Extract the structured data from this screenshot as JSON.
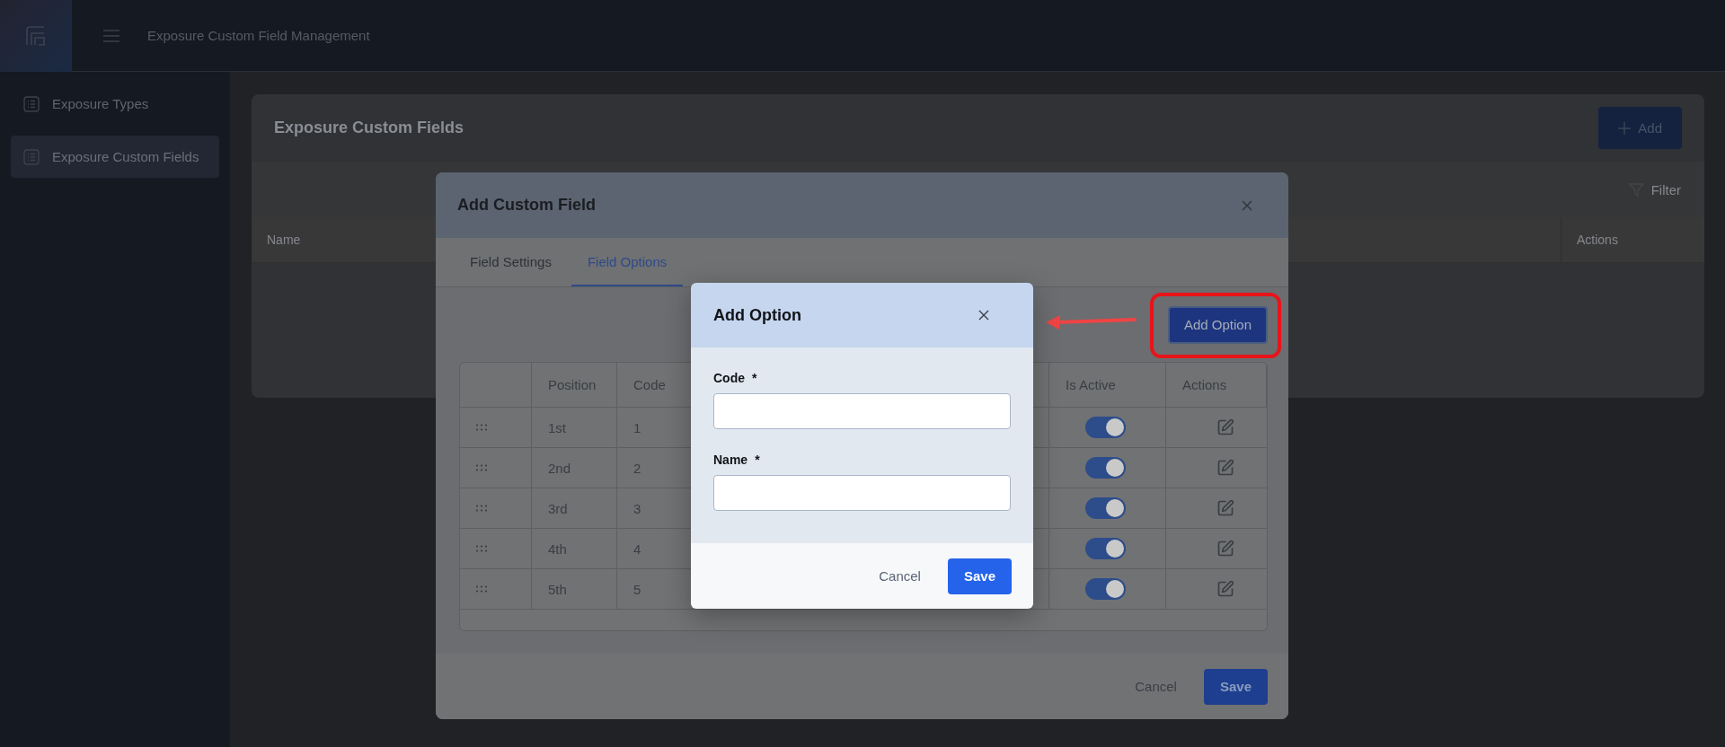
{
  "header": {
    "title": "Exposure Custom Field Management"
  },
  "sidebar": {
    "items": [
      {
        "label": "Exposure Types",
        "selected": false
      },
      {
        "label": "Exposure Custom Fields",
        "selected": true
      }
    ]
  },
  "page_card": {
    "title": "Exposure Custom Fields",
    "add_button": "Add",
    "filter_button": "Filter",
    "table": {
      "columns": [
        "Name",
        "Actions"
      ]
    }
  },
  "custom_field_dialog": {
    "title": "Add Custom Field",
    "tabs": [
      {
        "label": "Field Settings",
        "selected": false
      },
      {
        "label": "Field Options",
        "selected": true
      }
    ],
    "add_option_button": "Add Option",
    "table": {
      "columns": [
        "Position",
        "Code",
        "Is Active",
        "Actions"
      ],
      "rows": [
        {
          "position": "1st",
          "code": "1",
          "active": true
        },
        {
          "position": "2nd",
          "code": "2",
          "active": true
        },
        {
          "position": "3rd",
          "code": "3",
          "active": true
        },
        {
          "position": "4th",
          "code": "4",
          "active": true
        },
        {
          "position": "5th",
          "code": "5",
          "active": true
        }
      ]
    },
    "cancel_button": "Cancel",
    "save_button": "Save"
  },
  "option_dialog": {
    "title": "Add Option",
    "fields": [
      {
        "label": "Code",
        "marker": "*"
      },
      {
        "label": "Name",
        "marker": "*"
      }
    ],
    "cancel_button": "Cancel",
    "save_button": "Save"
  }
}
